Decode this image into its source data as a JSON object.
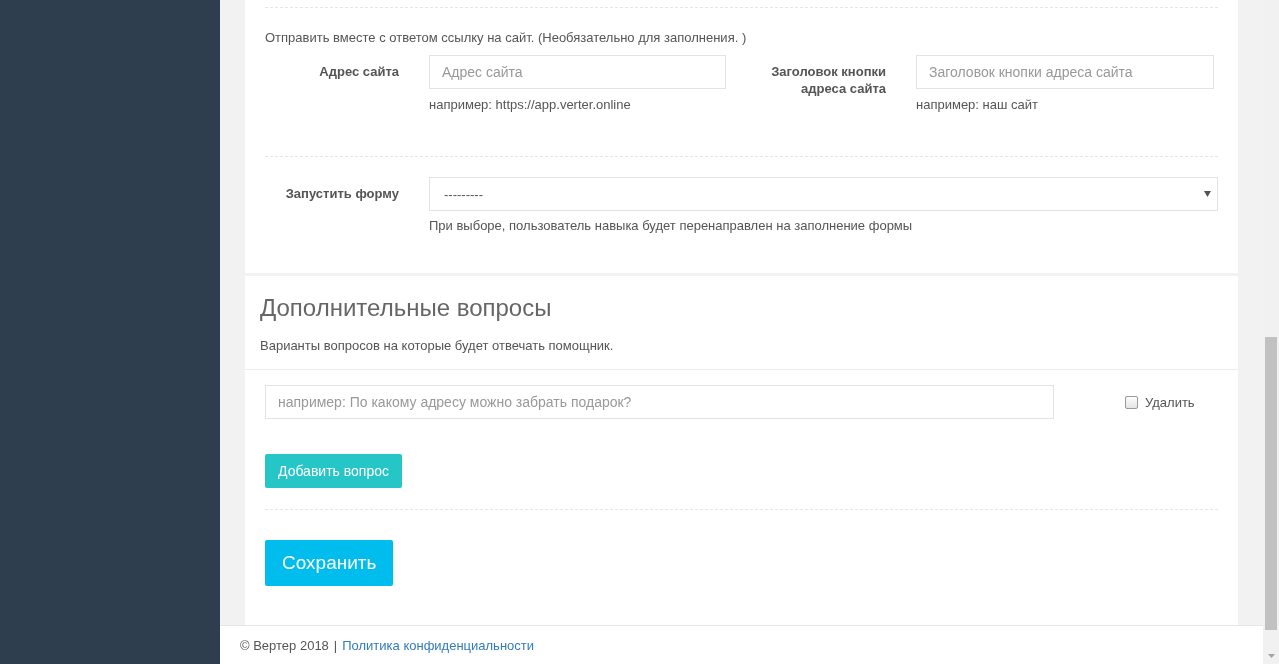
{
  "link_section": {
    "intro": "Отправить вместе с ответом ссылку на сайт. (Необязательно для заполнения. )",
    "fields": [
      {
        "label": "Адрес сайта",
        "placeholder": "Адрес сайта",
        "hint": "например: https://app.verter.online"
      },
      {
        "label": "Заголовок кнопки адреса сайта",
        "placeholder": "Заголовок кнопки адреса сайта",
        "hint": "например: наш сайт"
      }
    ]
  },
  "launch_form": {
    "label": "Запустить форму",
    "value": "---------",
    "hint": "При выборе, пользователь навыка будет перенаправлен на заполнение формы"
  },
  "extra_questions": {
    "title": "Дополнительные вопросы",
    "subtitle": "Варианты вопросов на которые будет отвечать помощник.",
    "questions": [
      {
        "placeholder": "например: По какому адресу можно забрать подарок?",
        "delete_label": "Удалить",
        "checked": false
      }
    ],
    "add_button": "Добавить вопрос"
  },
  "save_button": "Сохранить",
  "footer": {
    "copyright": "© Вертер 2018",
    "separator": "|",
    "link": "Политика конфиденциальности"
  }
}
